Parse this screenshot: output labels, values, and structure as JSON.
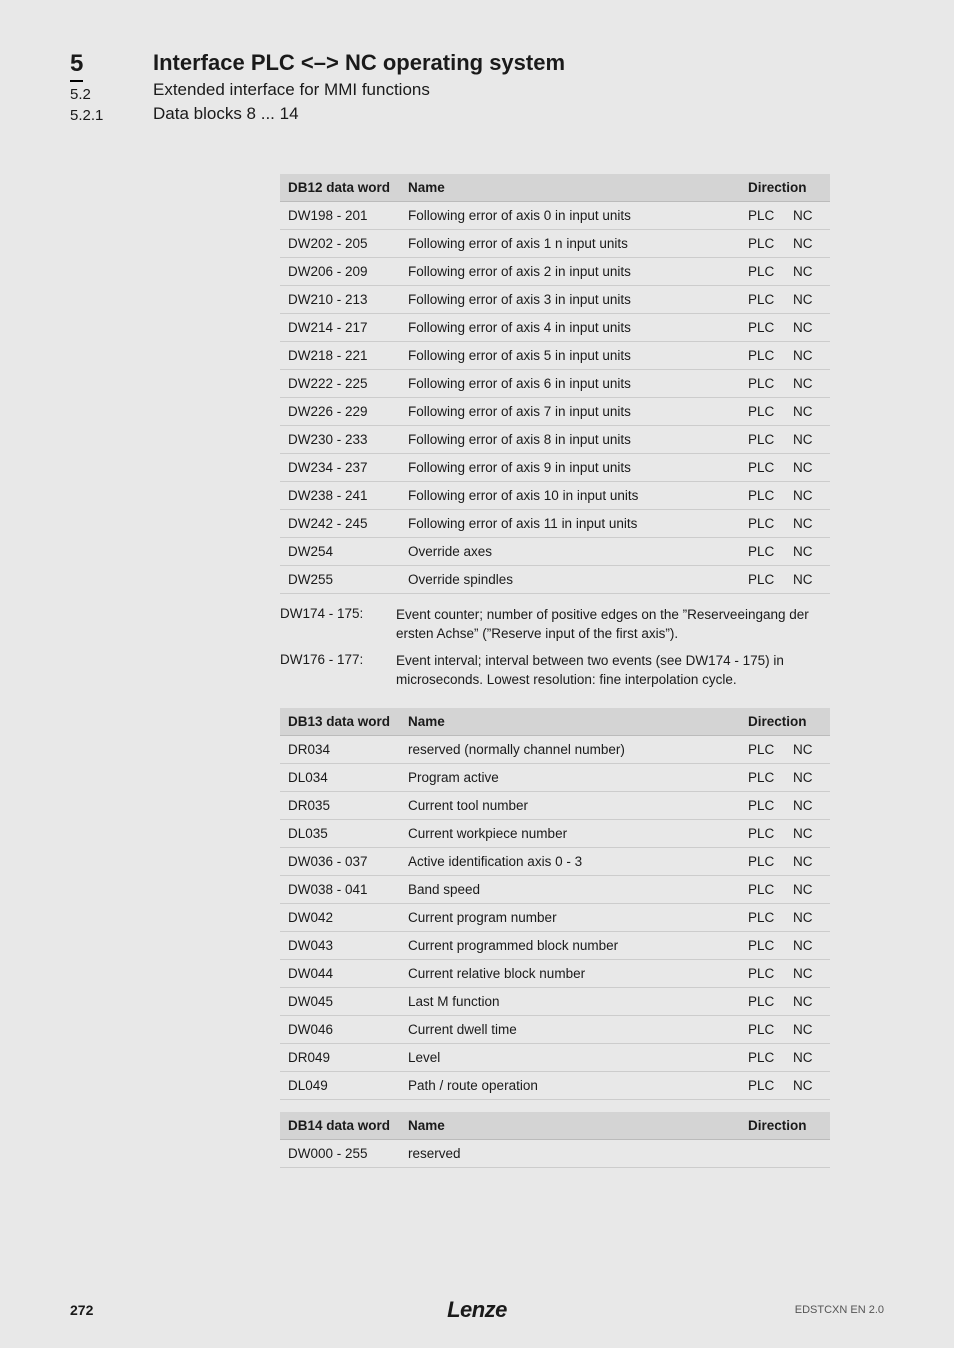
{
  "header": {
    "chapter_num": "5",
    "section_num": "5.2",
    "subsection_num": "5.2.1",
    "chapter_title": "Interface PLC <–> NC operating system",
    "section_title": "Extended interface for MMI functions",
    "subsection_title": "Data blocks 8 ... 14"
  },
  "table12": {
    "headers": {
      "dw": "DB12 data word",
      "name": "Name",
      "dir": "Direction"
    },
    "rows": [
      {
        "dw": "DW198 - 201",
        "name": "Following error of axis 0 in input units",
        "d1": "PLC",
        "d2": "NC"
      },
      {
        "dw": "DW202 - 205",
        "name": "Following error of axis 1 n input units",
        "d1": "PLC",
        "d2": "NC"
      },
      {
        "dw": "DW206 - 209",
        "name": "Following error of axis 2 in input units",
        "d1": "PLC",
        "d2": "NC"
      },
      {
        "dw": "DW210 - 213",
        "name": "Following error of axis 3 in input units",
        "d1": "PLC",
        "d2": "NC"
      },
      {
        "dw": "DW214 - 217",
        "name": "Following error of axis 4 in input units",
        "d1": "PLC",
        "d2": "NC"
      },
      {
        "dw": "DW218 - 221",
        "name": "Following error of axis 5 in input units",
        "d1": "PLC",
        "d2": "NC"
      },
      {
        "dw": "DW222 - 225",
        "name": "Following error of axis 6 in input units",
        "d1": "PLC",
        "d2": "NC"
      },
      {
        "dw": "DW226 - 229",
        "name": "Following error of axis 7 in input units",
        "d1": "PLC",
        "d2": "NC"
      },
      {
        "dw": "DW230 - 233",
        "name": "Following error of axis 8 in input units",
        "d1": "PLC",
        "d2": "NC"
      },
      {
        "dw": "DW234 - 237",
        "name": "Following error of axis 9 in input units",
        "d1": "PLC",
        "d2": "NC"
      },
      {
        "dw": "DW238 - 241",
        "name": "Following error of axis 10 in input units",
        "d1": "PLC",
        "d2": "NC"
      },
      {
        "dw": "DW242 - 245",
        "name": "Following error of axis 11 in input units",
        "d1": "PLC",
        "d2": "NC"
      },
      {
        "dw": "DW254",
        "name": "Override axes",
        "d1": "PLC",
        "d2": "NC"
      },
      {
        "dw": "DW255",
        "name": "Override spindles",
        "d1": "PLC",
        "d2": "NC"
      }
    ]
  },
  "notes": [
    {
      "label": "DW174 - 175:",
      "text": "Event counter; number of positive edges on the ”Reserveeingang der ersten Achse” (”Reserve input of the first axis”)."
    },
    {
      "label": "DW176 - 177:",
      "text": "Event interval; interval between two events (see DW174 - 175) in microseconds. Lowest resolution: fine interpolation cycle."
    }
  ],
  "table13": {
    "headers": {
      "dw": "DB13 data word",
      "name": "Name",
      "dir": "Direction"
    },
    "rows": [
      {
        "dw": "DR034",
        "name": "reserved (normally channel number)",
        "d1": "PLC",
        "d2": "NC"
      },
      {
        "dw": "DL034",
        "name": "Program active",
        "d1": "PLC",
        "d2": "NC"
      },
      {
        "dw": "DR035",
        "name": "Current tool number",
        "d1": "PLC",
        "d2": "NC"
      },
      {
        "dw": "DL035",
        "name": "Current workpiece number",
        "d1": "PLC",
        "d2": "NC"
      },
      {
        "dw": "DW036 - 037",
        "name": "Active identification axis 0 - 3",
        "d1": "PLC",
        "d2": "NC"
      },
      {
        "dw": "DW038 - 041",
        "name": "Band speed",
        "d1": "PLC",
        "d2": "NC"
      },
      {
        "dw": "DW042",
        "name": "Current program number",
        "d1": "PLC",
        "d2": "NC"
      },
      {
        "dw": "DW043",
        "name": "Current programmed block number",
        "d1": "PLC",
        "d2": "NC"
      },
      {
        "dw": "DW044",
        "name": "Current relative block number",
        "d1": "PLC",
        "d2": "NC"
      },
      {
        "dw": "DW045",
        "name": "Last M function",
        "d1": "PLC",
        "d2": "NC"
      },
      {
        "dw": "DW046",
        "name": "Current dwell time",
        "d1": "PLC",
        "d2": "NC"
      },
      {
        "dw": "DR049",
        "name": "Level",
        "d1": "PLC",
        "d2": "NC"
      },
      {
        "dw": "DL049",
        "name": "Path / route operation",
        "d1": "PLC",
        "d2": "NC"
      }
    ]
  },
  "table14": {
    "headers": {
      "dw": "DB14 data word",
      "name": "Name",
      "dir": "Direction"
    },
    "rows": [
      {
        "dw": "DW000 - 255",
        "name": "reserved",
        "d1": "",
        "d2": ""
      }
    ]
  },
  "footer": {
    "page": "272",
    "brand": "Lenze",
    "doc_id": "EDSTCXN EN 2.0"
  }
}
